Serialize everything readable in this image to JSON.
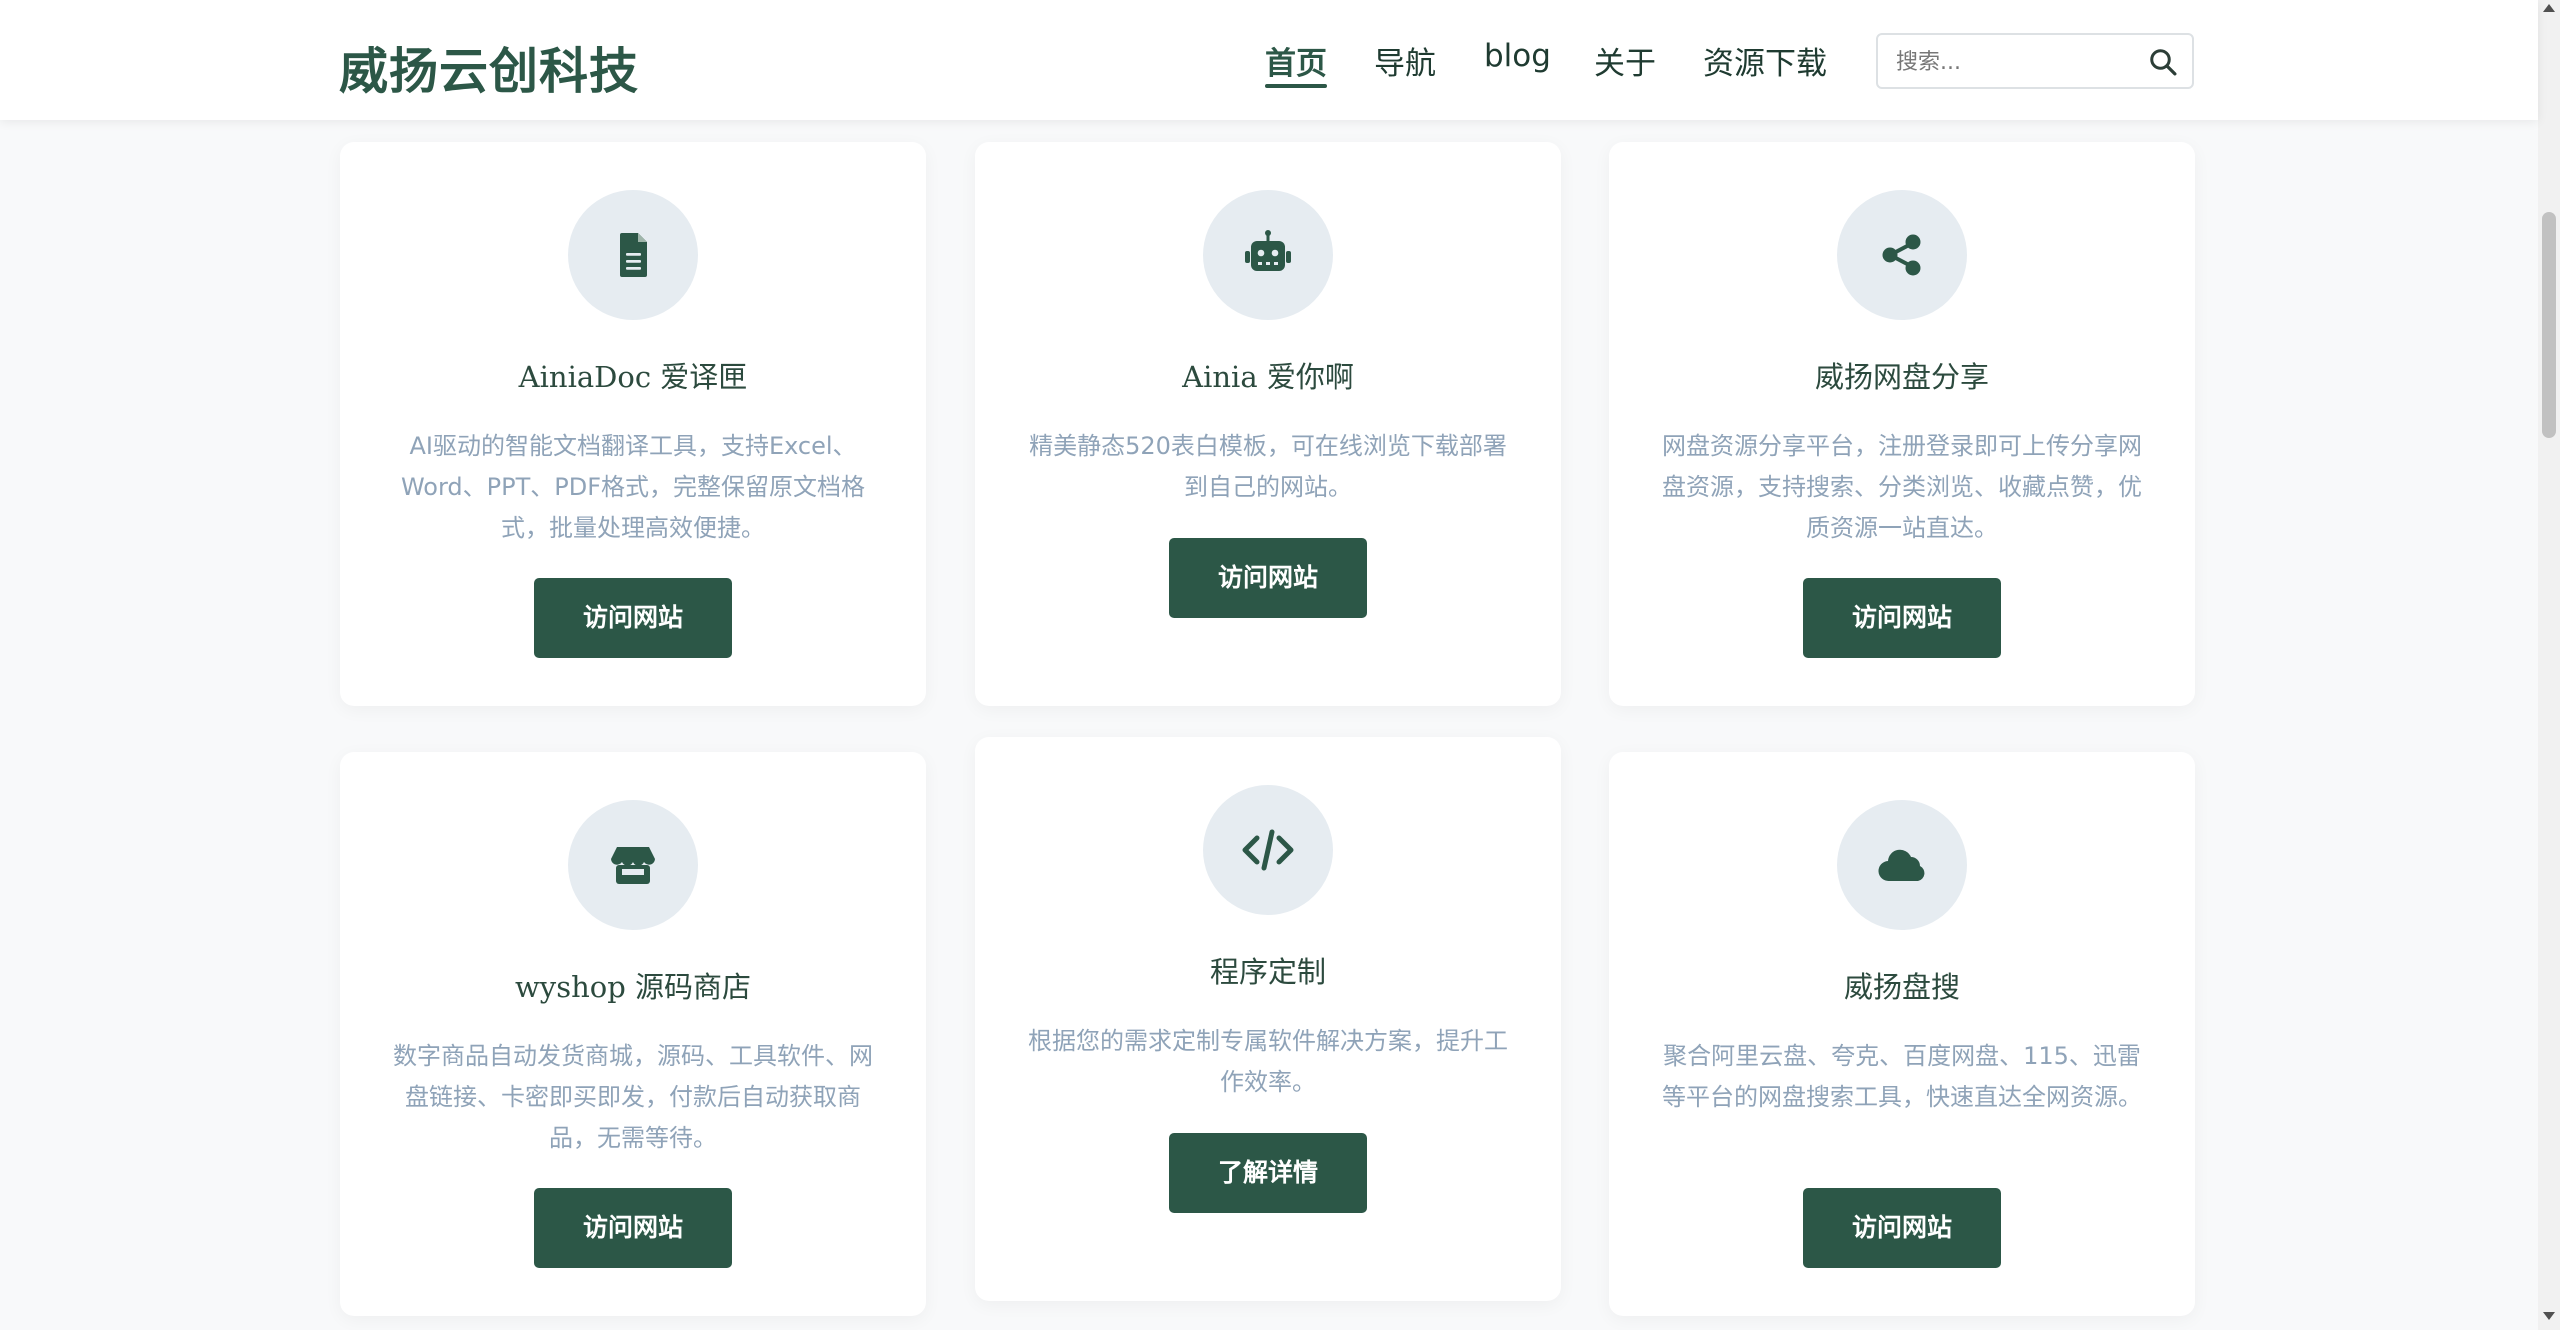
{
  "header": {
    "logo": "威扬云创科技",
    "nav": [
      {
        "label": "首页",
        "active": true
      },
      {
        "label": "导航",
        "active": false
      },
      {
        "label": "blog",
        "active": false
      },
      {
        "label": "关于",
        "active": false
      },
      {
        "label": "资源下载",
        "active": false
      }
    ],
    "search_placeholder": "搜索..."
  },
  "cards": [
    {
      "icon": "document-icon",
      "title": "AiniaDoc 爱译匣",
      "description": "AI驱动的智能文档翻译工具，支持Excel、Word、PPT、PDF格式，完整保留原文档格式，批量处理高效便捷。",
      "button": "访问网站"
    },
    {
      "icon": "robot-icon",
      "title": "Ainia 爱你啊",
      "description": "精美静态520表白模板，可在线浏览下载部署到自己的网站。",
      "button": "访问网站"
    },
    {
      "icon": "share-icon",
      "title": "威扬网盘分享",
      "description": "网盘资源分享平台，注册登录即可上传分享网盘资源，支持搜索、分类浏览、收藏点赞，优质资源一站直达。",
      "button": "访问网站"
    },
    {
      "icon": "store-icon",
      "title": "wyshop 源码商店",
      "description": "数字商品自动发货商城，源码、工具软件、网盘链接、卡密即买即发，付款后自动获取商品，无需等待。",
      "button": "访问网站"
    },
    {
      "icon": "code-icon",
      "title": "程序定制",
      "description": "根据您的需求定制专属软件解决方案，提升工作效率。",
      "button": "了解详情"
    },
    {
      "icon": "cloud-icon",
      "title": "威扬盘搜",
      "description": "聚合阿里云盘、夸克、百度网盘、115、迅雷等平台的网盘搜索工具，快速直达全网资源。",
      "button": "访问网站"
    }
  ],
  "colors": {
    "accent": "#2c5747",
    "icon_background": "#e6ecf1",
    "description_text": "#8fa3b8"
  }
}
